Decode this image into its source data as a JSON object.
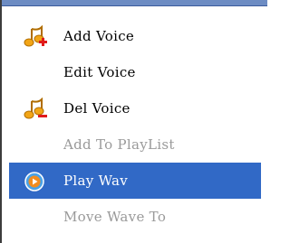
{
  "menu": {
    "items": [
      {
        "label": "Add Voice",
        "icon": "music-note-add-icon",
        "state": "normal"
      },
      {
        "label": "Edit Voice",
        "icon": "",
        "state": "normal"
      },
      {
        "label": "Del Voice",
        "icon": "music-note-delete-icon",
        "state": "normal"
      },
      {
        "label": "Add To PlayList",
        "icon": "",
        "state": "disabled"
      },
      {
        "label": "Play Wav",
        "icon": "media-play-icon",
        "state": "selected"
      },
      {
        "label": "Move Wave To",
        "icon": "",
        "state": "disabled"
      }
    ]
  },
  "colors": {
    "selection": "#3169c6",
    "disabled_text": "#9a9a9a",
    "note_icon": "#f2a516",
    "add_badge": "#e01a1a",
    "delete_badge": "#e01a1a"
  }
}
